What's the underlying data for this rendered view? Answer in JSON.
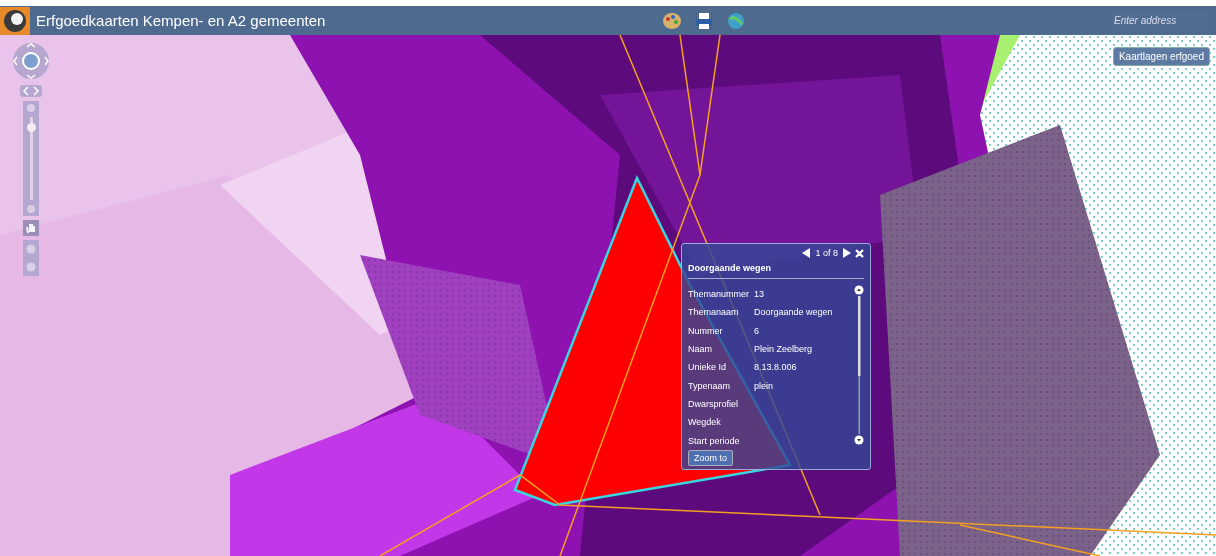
{
  "header": {
    "title": "Erfgoedkaarten Kempen- en A2 gemeenten",
    "address_placeholder": "Enter address"
  },
  "layers_button": {
    "label": "Kaartlagen erfgoed"
  },
  "zoom_slider": {
    "level": 0.88
  },
  "popup": {
    "pager": "1 of 8",
    "title": "Doorgaande wegen",
    "fields": [
      {
        "label": "Themanummer",
        "value": "13"
      },
      {
        "label": "Themanaam",
        "value": "Doorgaande wegen"
      },
      {
        "label": "Nummer",
        "value": "6"
      },
      {
        "label": "Naam",
        "value": "Plein Zeelberg"
      },
      {
        "label": "Unieke Id",
        "value": "8.13.8.006"
      },
      {
        "label": "Typenaam",
        "value": "plein"
      },
      {
        "label": "Dwarsprofiel"
      },
      {
        "label": "Wegdek"
      },
      {
        "label": "Start periode"
      }
    ],
    "button": "Zoom to"
  }
}
